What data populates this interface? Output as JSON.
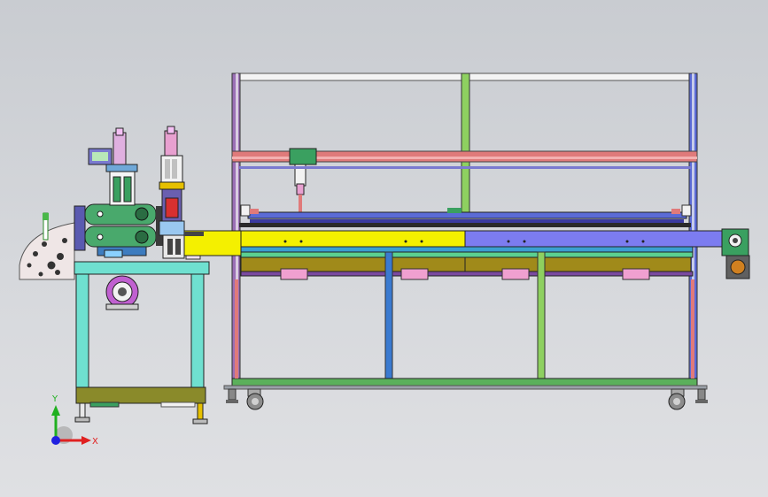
{
  "viewport": {
    "background": "#d3d5d9"
  },
  "triad": {
    "x_label": "X",
    "y_label": "Y",
    "x_color": "#e02020",
    "y_color": "#20b020",
    "z_color": "#2020e0"
  },
  "palette": {
    "frame_top": "#f2f2f2",
    "frame_mid": "#e07a7a",
    "frame_post": "#9a6fb5",
    "frame_post2": "#5b6bd6",
    "beam_yellow": "#f4f000",
    "beam_blue": "#7c7cf0",
    "beam_olive": "#a08a1a",
    "base_green": "#2e8b57",
    "table_cyan": "#6fe0d0",
    "table_olive": "#8a8a2a",
    "wheel": "#808080",
    "head_green": "#3aa060"
  }
}
